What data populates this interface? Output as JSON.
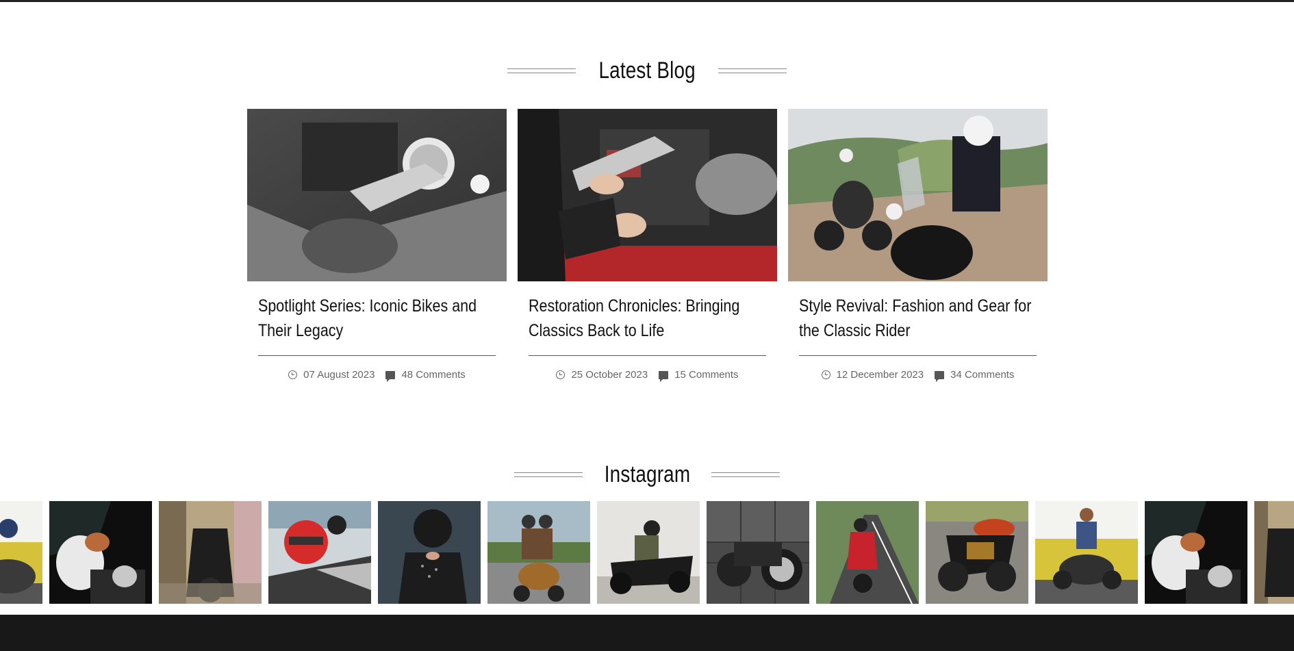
{
  "blog": {
    "title": "Latest Blog",
    "posts": [
      {
        "title": "Spotlight Series: Iconic Bikes and Their Legacy",
        "date": "07 August 2023",
        "comments": "48 Comments"
      },
      {
        "title": "Restoration Chronicles: Bringing Classics Back to Life",
        "date": "25 October 2023",
        "comments": "15 Comments"
      },
      {
        "title": "Style Revival: Fashion and Gear for the Classic Rider",
        "date": "12 December 2023",
        "comments": "34 Comments"
      }
    ]
  },
  "instagram": {
    "title": "Instagram"
  },
  "icons": {
    "date": "clock-icon",
    "comments": "comment-icon"
  }
}
